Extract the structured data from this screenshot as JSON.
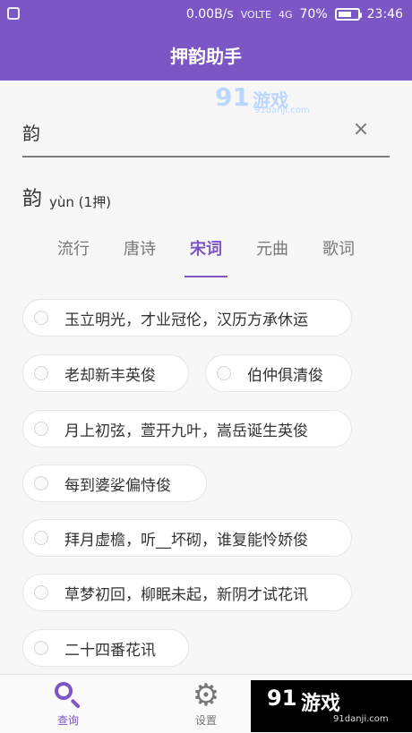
{
  "status": {
    "speed": "0.00B/s",
    "volte": "VOLTE",
    "signal": "4G",
    "battery": "70%",
    "battery_level": 0.7,
    "time": "23:46"
  },
  "app": {
    "title": "押韵助手"
  },
  "watermark_top": {
    "logo": "91",
    "text": "游戏",
    "url": "91danji.com"
  },
  "search": {
    "value": "韵",
    "placeholder": ""
  },
  "rhyme": {
    "char": "韵",
    "pinyin": "yùn (1押)"
  },
  "tabs": [
    "流行",
    "唐诗",
    "宋词",
    "元曲",
    "歌词"
  ],
  "active_tab": "宋词",
  "results": [
    "玉立明光，才业冠伦，汉历方承休运",
    "老却新丰英俊",
    "伯仲俱清俊",
    "月上初弦，萱开九叶，嵩岳诞生英俊",
    "每到婆娑偏恃俊",
    "拜月虚檐，听__坏砌，谁复能怜娇俊",
    "草梦初回，柳眠未起，新阴才试花讯",
    "二十四番花讯"
  ],
  "bottom_nav": [
    {
      "label": "查询",
      "icon": "search-icon",
      "active": true
    },
    {
      "label": "设置",
      "icon": "gear-icon",
      "active": false
    }
  ],
  "watermark_bottom": {
    "logo": "91",
    "text": "游戏",
    "url": "91danji.com"
  },
  "colors": {
    "accent": "#7b56c4"
  }
}
